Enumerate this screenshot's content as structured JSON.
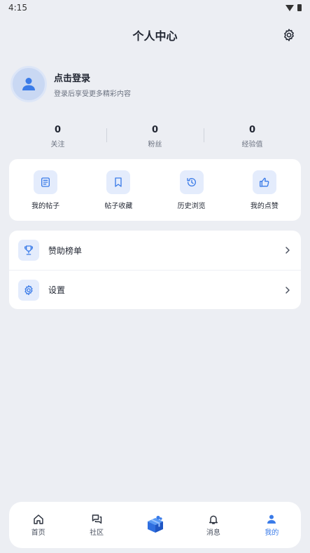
{
  "status_bar": {
    "time": "4:15"
  },
  "header": {
    "title": "个人中心",
    "settings_icon": "gear-icon"
  },
  "profile": {
    "title": "点击登录",
    "subtitle": "登录后享受更多精彩内容",
    "avatar_icon": "user-icon"
  },
  "stats": [
    {
      "value": "0",
      "label": "关注"
    },
    {
      "value": "0",
      "label": "粉丝"
    },
    {
      "value": "0",
      "label": "经验值"
    }
  ],
  "quick_actions": [
    {
      "label": "我的帖子",
      "icon": "document-icon"
    },
    {
      "label": "帖子收藏",
      "icon": "bookmark-icon"
    },
    {
      "label": "历史浏览",
      "icon": "history-icon"
    },
    {
      "label": "我的点赞",
      "icon": "thumbs-up-icon"
    }
  ],
  "menu": [
    {
      "label": "赞助榜单",
      "icon": "trophy-icon"
    },
    {
      "label": "设置",
      "icon": "gear-icon"
    }
  ],
  "bottom_nav": [
    {
      "label": "首页",
      "icon": "home-icon"
    },
    {
      "label": "社区",
      "icon": "chat-icon"
    },
    {
      "label": "",
      "icon": "gift-box-icon"
    },
    {
      "label": "消息",
      "icon": "bell-icon"
    },
    {
      "label": "我的",
      "icon": "user-icon",
      "active": true
    }
  ],
  "colors": {
    "accent": "#3a7be8",
    "icon_bg": "#e4ecfc",
    "page_bg": "#eceef3"
  }
}
